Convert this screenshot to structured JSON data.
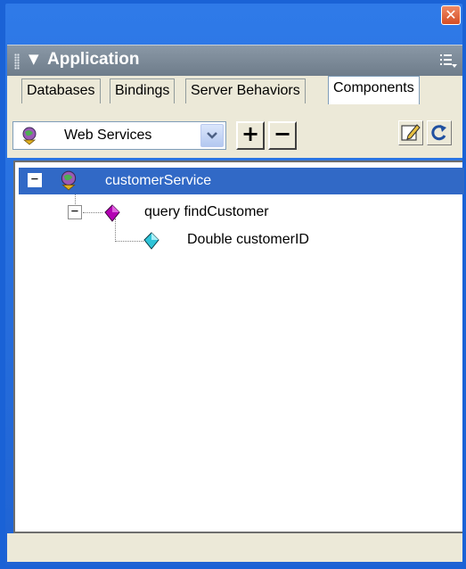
{
  "window": {
    "close_glyph": "✕",
    "accent_color": "#1f63d3"
  },
  "panel": {
    "collapse_glyph": "▼",
    "title": "Application",
    "options_icon": "options-menu-icon"
  },
  "tabs": [
    {
      "label": "Databases",
      "active": false
    },
    {
      "label": "Bindings",
      "active": false
    },
    {
      "label": "Server Behaviors",
      "active": false
    },
    {
      "label": "Components",
      "active": true
    }
  ],
  "toolbar": {
    "component_type": "Web Services",
    "component_type_icon": "web-service-icon",
    "add_label": "+",
    "remove_label": "−",
    "edit_icon": "edit-icon",
    "refresh_icon": "refresh-icon"
  },
  "tree": {
    "service": {
      "label": "customerService",
      "expanded": true,
      "selected": true,
      "expander": "−"
    },
    "method": {
      "label": "query findCustomer",
      "expanded": true,
      "expander": "−"
    },
    "param": {
      "label": "Double customerID"
    }
  },
  "colors": {
    "selection": "#3169c6",
    "method_icon": "#b400b4",
    "param_icon": "#2fc4d8"
  }
}
